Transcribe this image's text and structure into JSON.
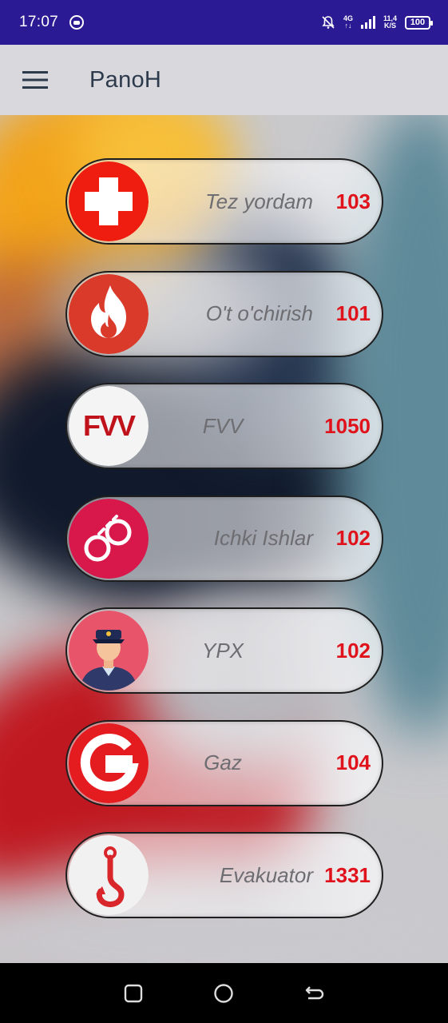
{
  "status_bar": {
    "time": "17:07",
    "network": "4G",
    "speed_value": "11,4",
    "speed_unit": "K/S",
    "battery": "100"
  },
  "app_bar": {
    "title": "PanoH",
    "menu_icon": "hamburger-menu-icon"
  },
  "services": [
    {
      "label": "Tez yordam",
      "number": "103",
      "icon": "medical-cross-icon",
      "icon_color": "#ee1d10"
    },
    {
      "label": "O't o'chirish",
      "number": "101",
      "icon": "fire-icon",
      "icon_color": "#d93a2a"
    },
    {
      "label": "FVV",
      "number": "1050",
      "icon": "fvv-logo-icon",
      "icon_color": "#c0121a"
    },
    {
      "label": "Ichki Ishlar",
      "number": "102",
      "icon": "handcuffs-icon",
      "icon_color": "#d8174a"
    },
    {
      "label": "YPX",
      "number": "102",
      "icon": "police-officer-icon",
      "icon_color": "#e8546a"
    },
    {
      "label": "Gaz",
      "number": "104",
      "icon": "gas-g-logo-icon",
      "icon_color": "#e41c20"
    },
    {
      "label": "Evakuator",
      "number": "1331",
      "icon": "tow-hook-icon",
      "icon_color": "#d9262b"
    }
  ],
  "nav_bar": {
    "items": [
      "recent-apps-icon",
      "home-icon",
      "back-icon"
    ]
  },
  "colors": {
    "status_bar": "#2a1b94",
    "app_bar": "#d9d8dc",
    "number_red": "#e0121b",
    "label_gray": "#6d6d72"
  }
}
